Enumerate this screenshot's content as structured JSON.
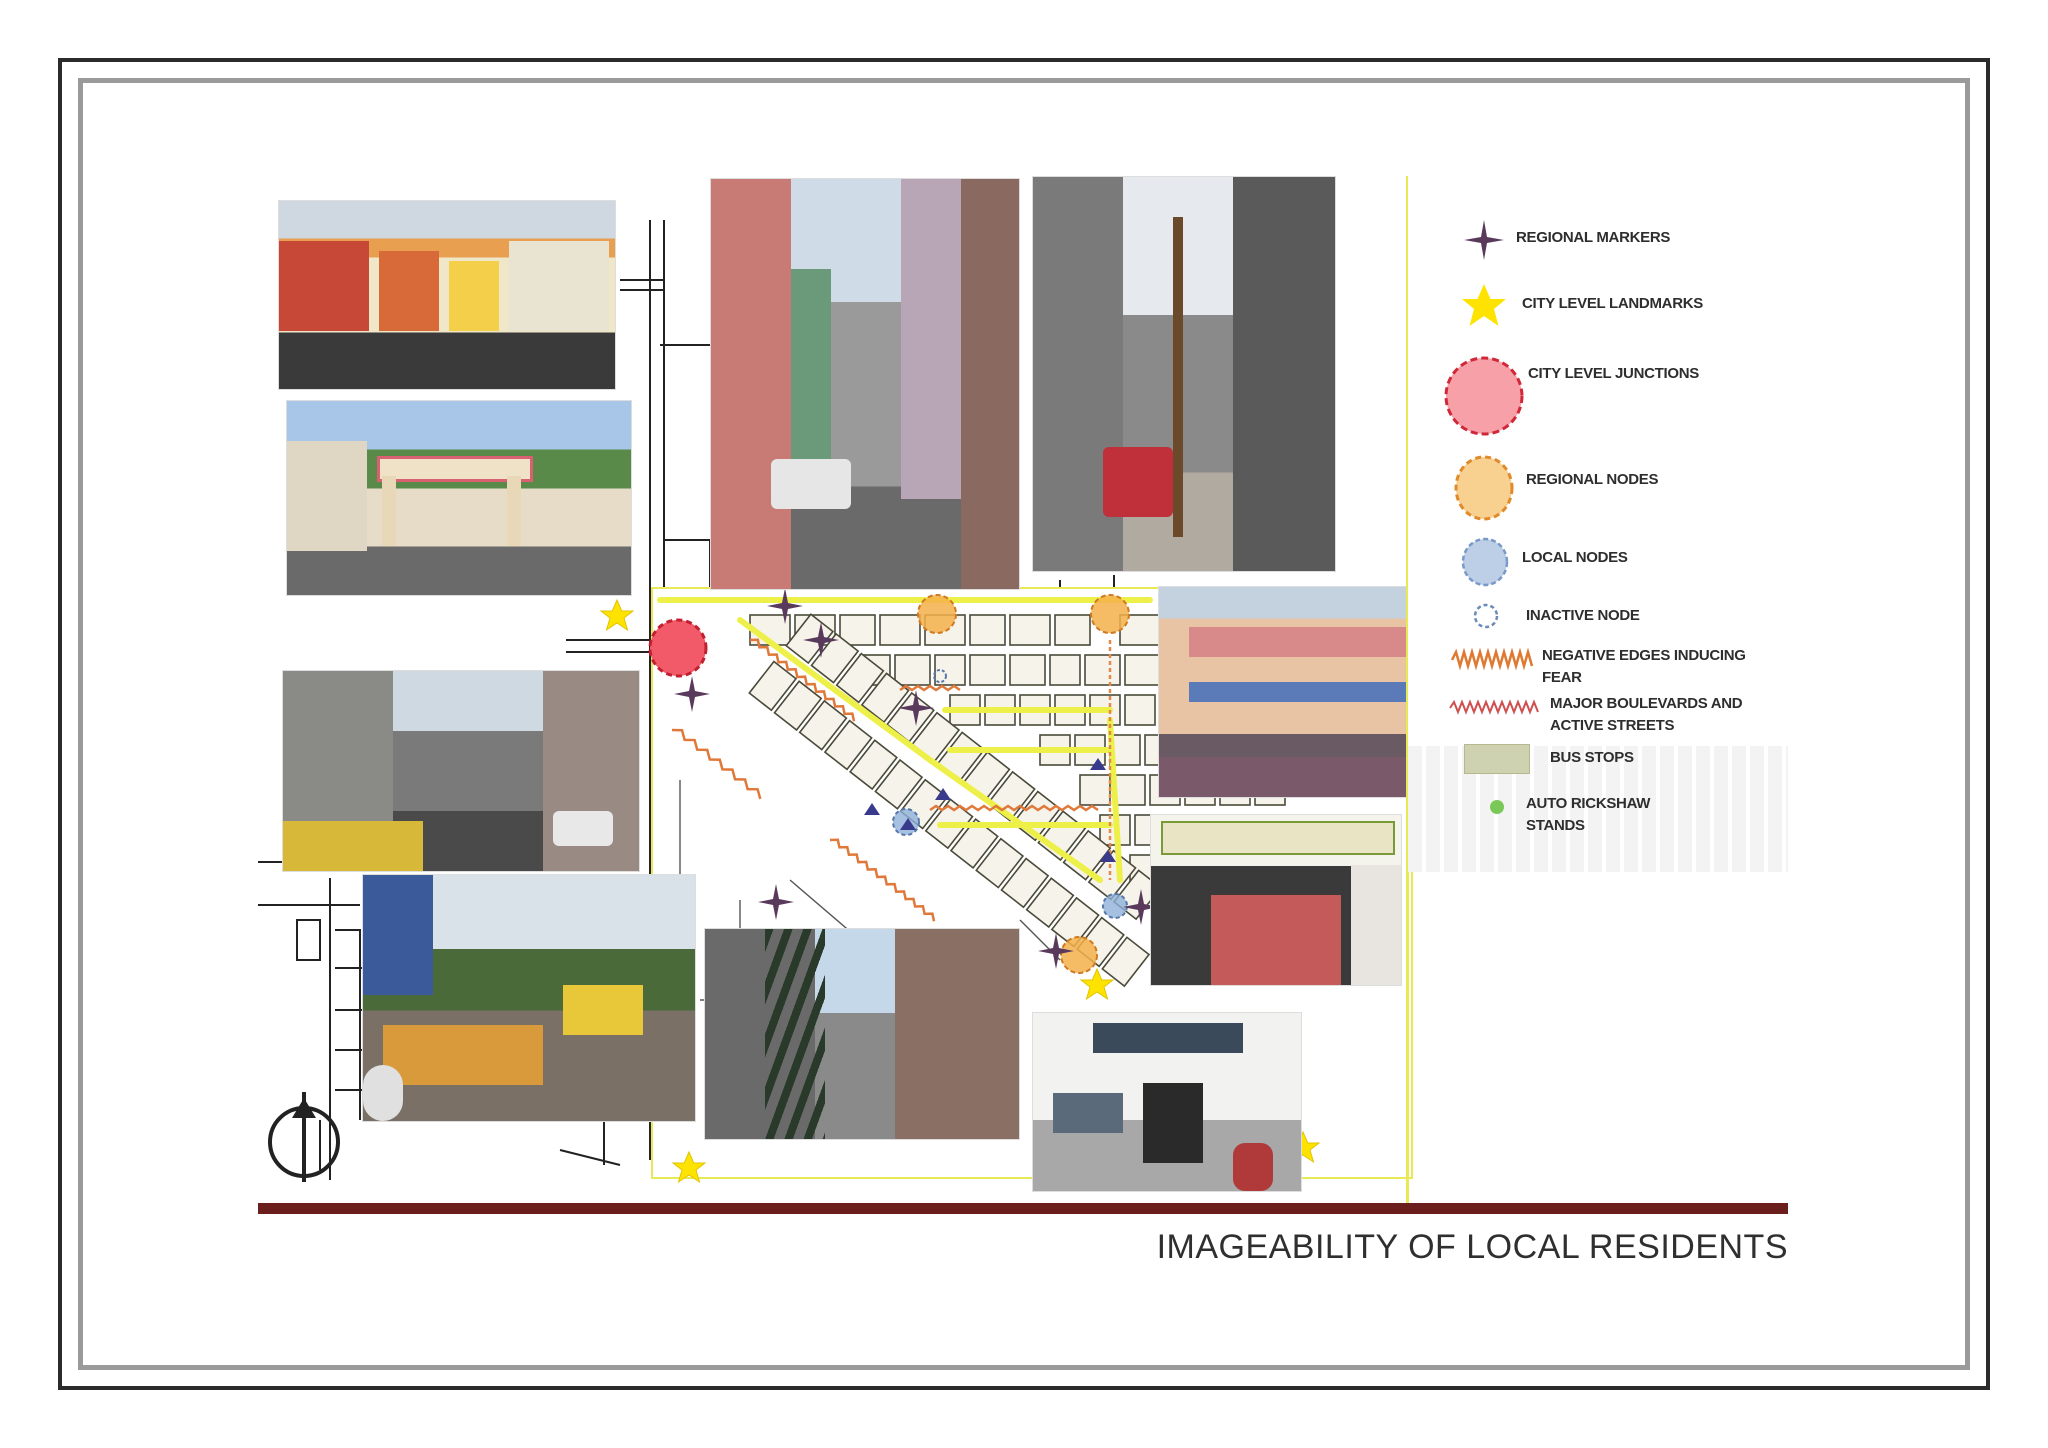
{
  "caption": "IMAGEABILITY OF LOCAL RESIDENTS",
  "legend": {
    "items": [
      {
        "label": "REGIONAL MARKERS",
        "icon": "compass-star"
      },
      {
        "label": "CITY LEVEL LANDMARKS",
        "icon": "yellow-star"
      },
      {
        "label": "CITY LEVEL JUNCTIONS",
        "icon": "red-circle"
      },
      {
        "label": "REGIONAL NODES",
        "icon": "orange-circle"
      },
      {
        "label": "LOCAL NODES",
        "icon": "blue-circle"
      },
      {
        "label": "INACTIVE NODE",
        "icon": "dashed-circle"
      },
      {
        "label": "NEGATIVE EDGES INDUCING",
        "label2": "FEAR",
        "icon": "zigzag-orange"
      },
      {
        "label": "MAJOR BOULEVARDS AND",
        "label2": "ACTIVE STREETS",
        "icon": "zigzag-red"
      },
      {
        "label": "BUS STOPS",
        "icon": "bus-stop-patch"
      },
      {
        "label": "AUTO RICKSHAW",
        "label2": "STANDS",
        "icon": "green-dot"
      }
    ]
  },
  "colors": {
    "frame": "#2b2b2b",
    "bar": "#6b1f1c",
    "junction": "#f25a6a",
    "regional_node": "#f5b04a",
    "local_node": "#8fb0d8",
    "landmark": "#ffe300",
    "marker": "#5a3a5c"
  }
}
